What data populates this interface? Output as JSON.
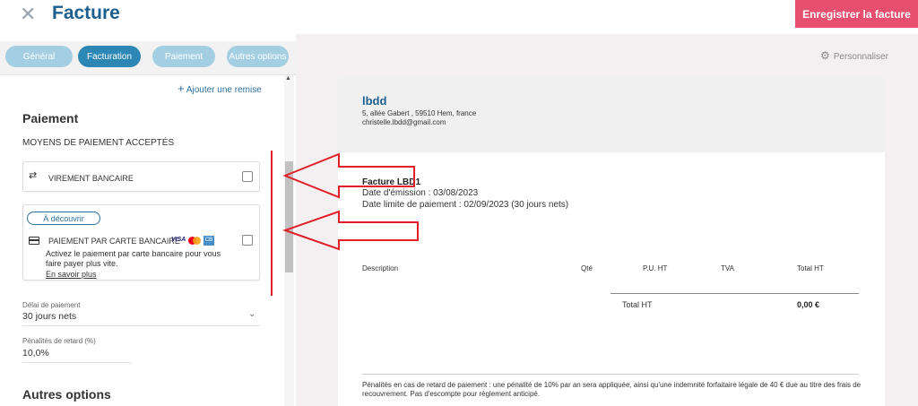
{
  "header": {
    "title": "Facture",
    "save_label": "Enregistrer la facture"
  },
  "tabs": [
    {
      "label": "Général",
      "active": false
    },
    {
      "label": "Facturation",
      "active": true
    },
    {
      "label": "Paiement",
      "active": false
    },
    {
      "label": "Autres options",
      "active": false
    }
  ],
  "left": {
    "add_remise": "Ajouter une remise",
    "paiement_title": "Paiement",
    "moyens_title": "MOYENS DE PAIEMENT ACCEPTÉS",
    "virement_label": "VIREMENT BANCAIRE",
    "decouvrir_label": "À découvrir",
    "carte_label": "PAIEMENT PAR CARTE BANCAIRE",
    "visa_text": "VISA",
    "cb_text": "CB",
    "carte_desc": "Activez le paiement par carte bancaire pour vous faire payer plus vite.",
    "en_savoir": "En savoir plus",
    "delai_label": "Délai de paiement",
    "delai_value": "30 jours nets",
    "penal_label": "Pénalités de retard (%)",
    "penal_value": "10,0%",
    "autres_title": "Autres options"
  },
  "preview": {
    "personnaliser": "Personnaliser",
    "company": "lbdd",
    "address1": "5, allée Gabert , 59510 Hem, france",
    "address2": "christelle.lbdd@gmail.com",
    "invoice_number": "Facture LBD1",
    "emission": "Date d'émission : 03/08/2023",
    "limite": "Date limite de paiement : 02/09/2023 (30 jours nets)",
    "columns": [
      "Description",
      "Qté",
      "P.U. HT",
      "TVA",
      "Total HT"
    ],
    "total_label": "Total HT",
    "total_value": "0,00 €",
    "footer": "Pénalités en cas de retard de paiement : une pénalité de 10% par an sera appliquée, ainsi qu'une indemnité forfaitaire légale de 40 € due au titre des frais de recouvrement. Pas d'escompte pour règlement anticipé."
  },
  "colors": {
    "brand_blue": "#1d5f8f",
    "save_pink": "#e6506e",
    "annotation_red": "#e0202a"
  }
}
